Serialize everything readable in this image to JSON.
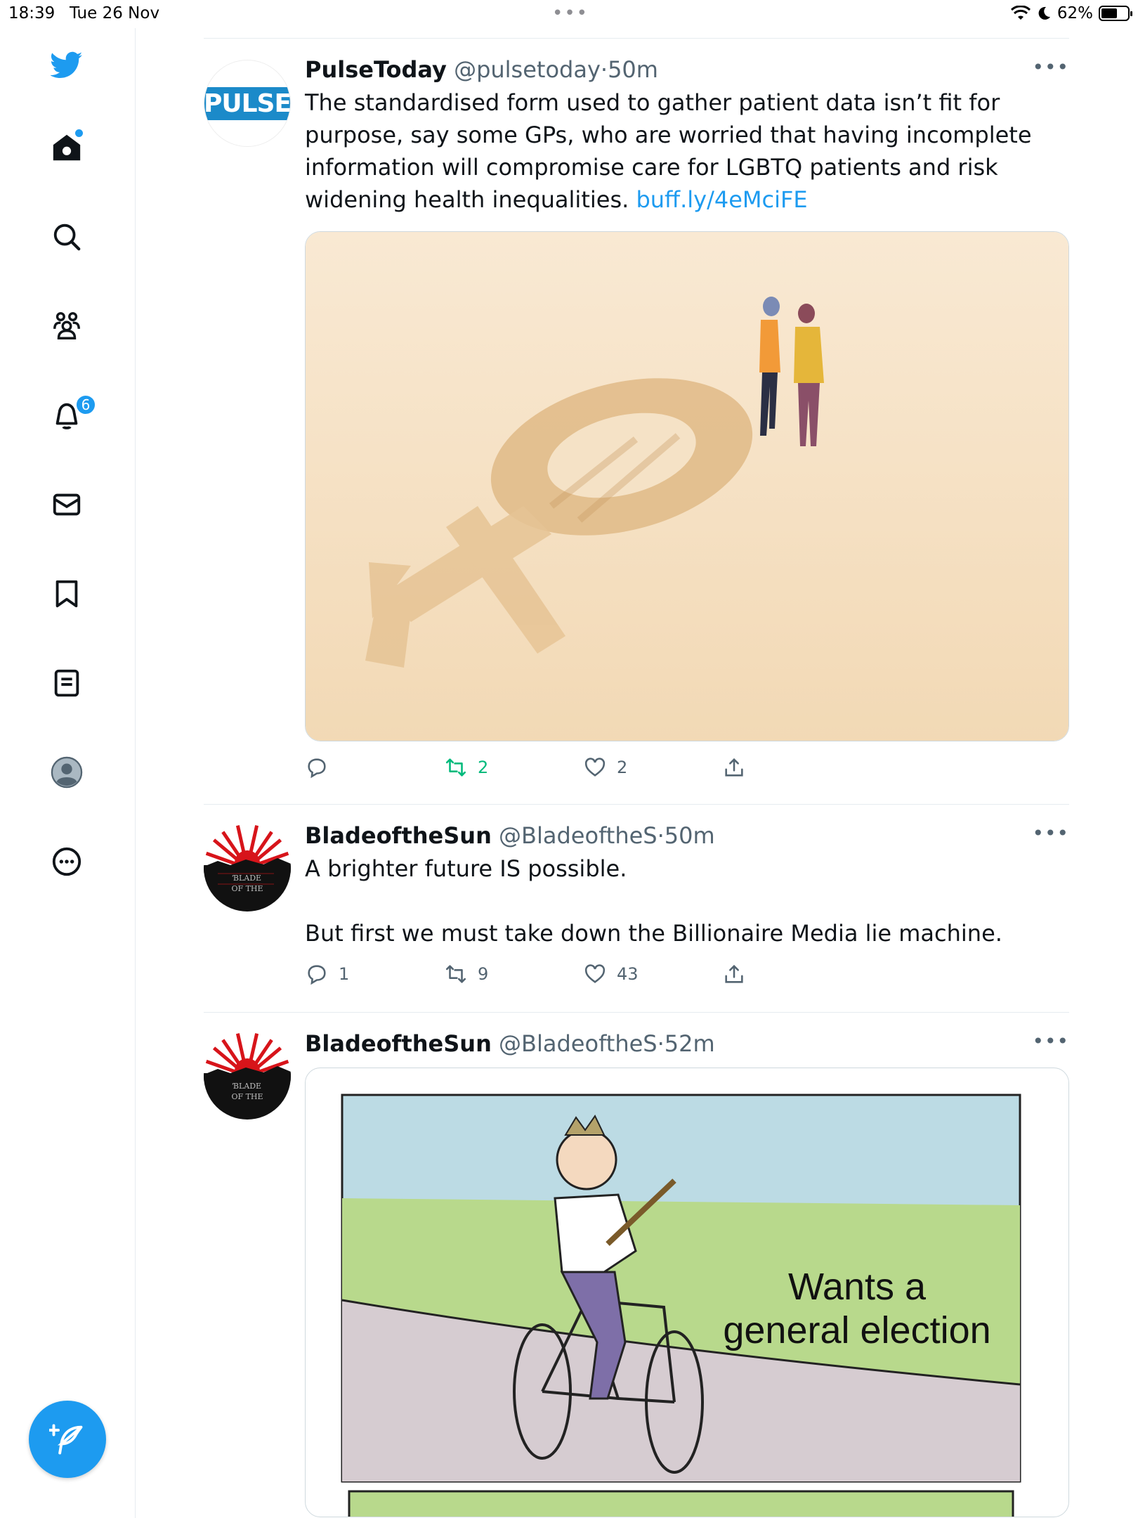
{
  "status_bar": {
    "time": "18:39",
    "date": "Tue 26 Nov",
    "dots": "•••",
    "battery": "62%",
    "battery_level": 0.62
  },
  "sidebar": {
    "notifications_badge": "6",
    "items": [
      {
        "name": "twitter-logo-icon"
      },
      {
        "name": "home-icon"
      },
      {
        "name": "search-icon"
      },
      {
        "name": "communities-icon"
      },
      {
        "name": "notifications-icon"
      },
      {
        "name": "messages-icon"
      },
      {
        "name": "bookmarks-icon"
      },
      {
        "name": "lists-icon"
      },
      {
        "name": "profile-icon"
      },
      {
        "name": "more-icon"
      }
    ],
    "compose_icon": "compose-tweet-icon"
  },
  "colors": {
    "accent": "#1d9bf0",
    "retweet_green": "#00ba7c",
    "text_secondary": "#536471"
  },
  "tweets": [
    {
      "name": "PulseToday",
      "handle": "@pulsetoday",
      "sep": "·",
      "time": "50m",
      "text": "The standardised form used to gather patient data isn’t fit for purpose, say some GPs, who are worried that having incomplete information will compromise care for LGBTQ patients and risk widening health inequalities.",
      "link": "buff.ly/4eMciFE",
      "avatar_text": "PULSE",
      "reply_count": "",
      "retweet_count": "2",
      "like_count": "2"
    },
    {
      "name": "BladeoftheSun",
      "handle": "@BladeoftheS",
      "sep": "·",
      "time": "50m",
      "text": "A brighter future IS possible.\n\nBut first we must take down the Billionaire Media lie machine.",
      "reply_count": "1",
      "retweet_count": "9",
      "like_count": "43"
    },
    {
      "name": "BladeoftheSun",
      "handle": "@BladeoftheS",
      "sep": "·",
      "time": "52m",
      "meme_caption": "Wants a\ngeneral election"
    }
  ],
  "more_label": "•••"
}
